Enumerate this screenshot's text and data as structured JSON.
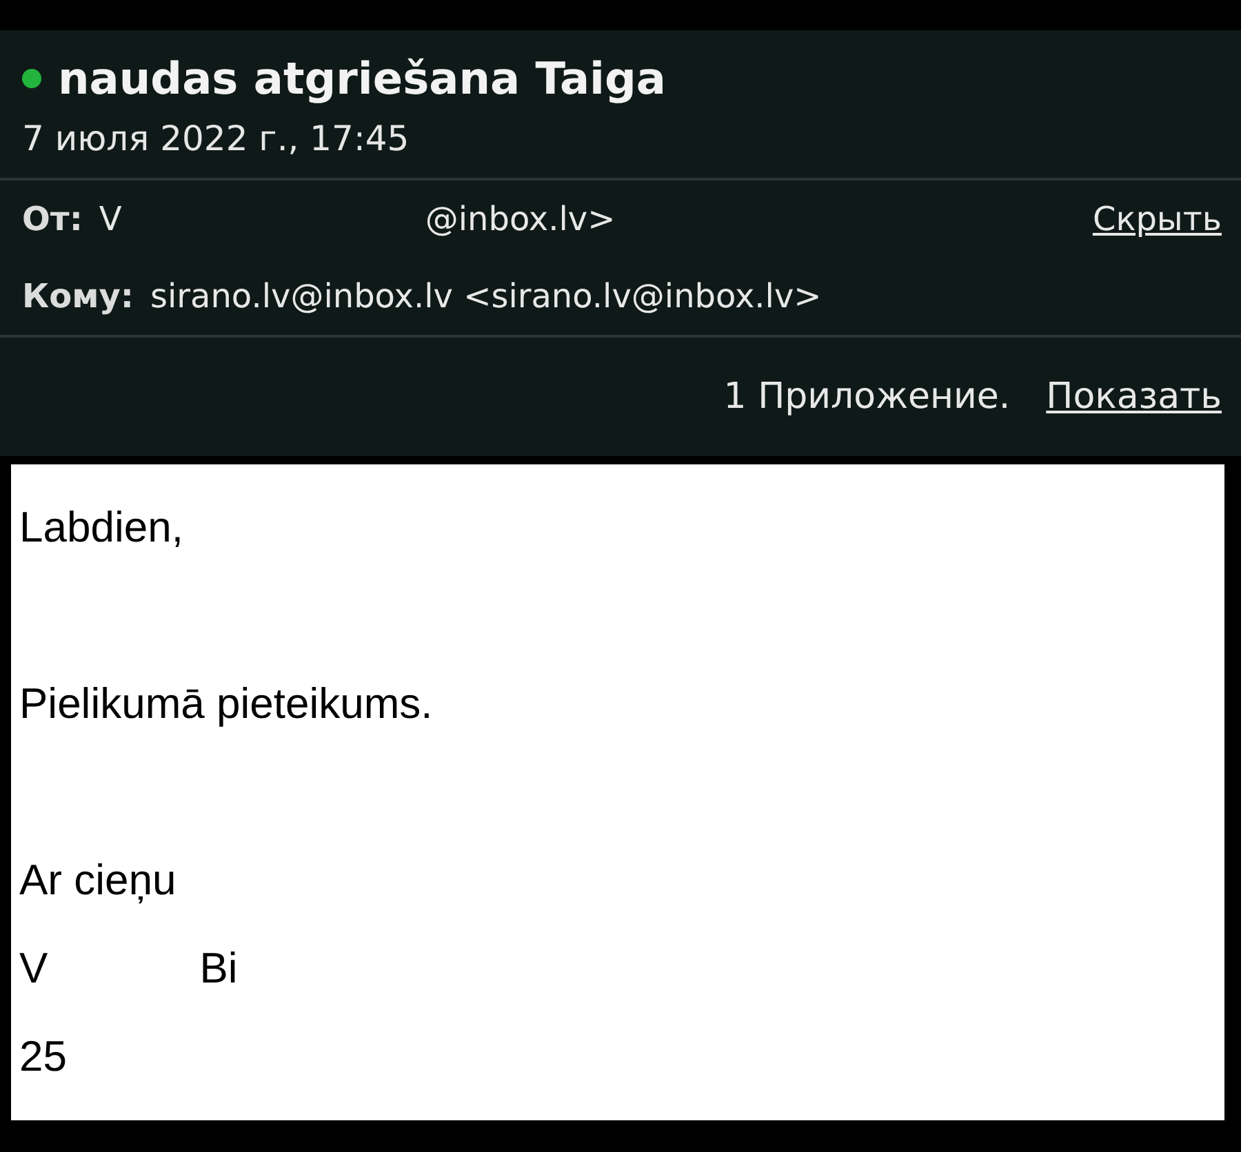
{
  "message": {
    "unread": true,
    "subject": "naudas atgriešana Taiga",
    "date": "7 июля 2022 г., 17:45",
    "from": {
      "label": "От:",
      "name_start": "V",
      "address_end": "@inbox.lv>",
      "action": "Скрыть"
    },
    "to": {
      "label": "Кому:",
      "value": "sirano.lv@inbox.lv <sirano.lv@inbox.lv>"
    },
    "attachments": {
      "count": "1 Приложение.",
      "action": "Показать"
    },
    "body": [
      {
        "kind": "text",
        "parts": [
          "Labdien,"
        ]
      },
      {
        "kind": "blank"
      },
      {
        "kind": "text",
        "parts": [
          "Pielikumā pieteikums."
        ]
      },
      {
        "kind": "blank"
      },
      {
        "kind": "text",
        "parts": [
          "Ar cieņu"
        ]
      },
      {
        "kind": "text",
        "parts": [
          "V",
          "Bi"
        ]
      },
      {
        "kind": "text",
        "parts": [
          "25"
        ]
      }
    ]
  }
}
